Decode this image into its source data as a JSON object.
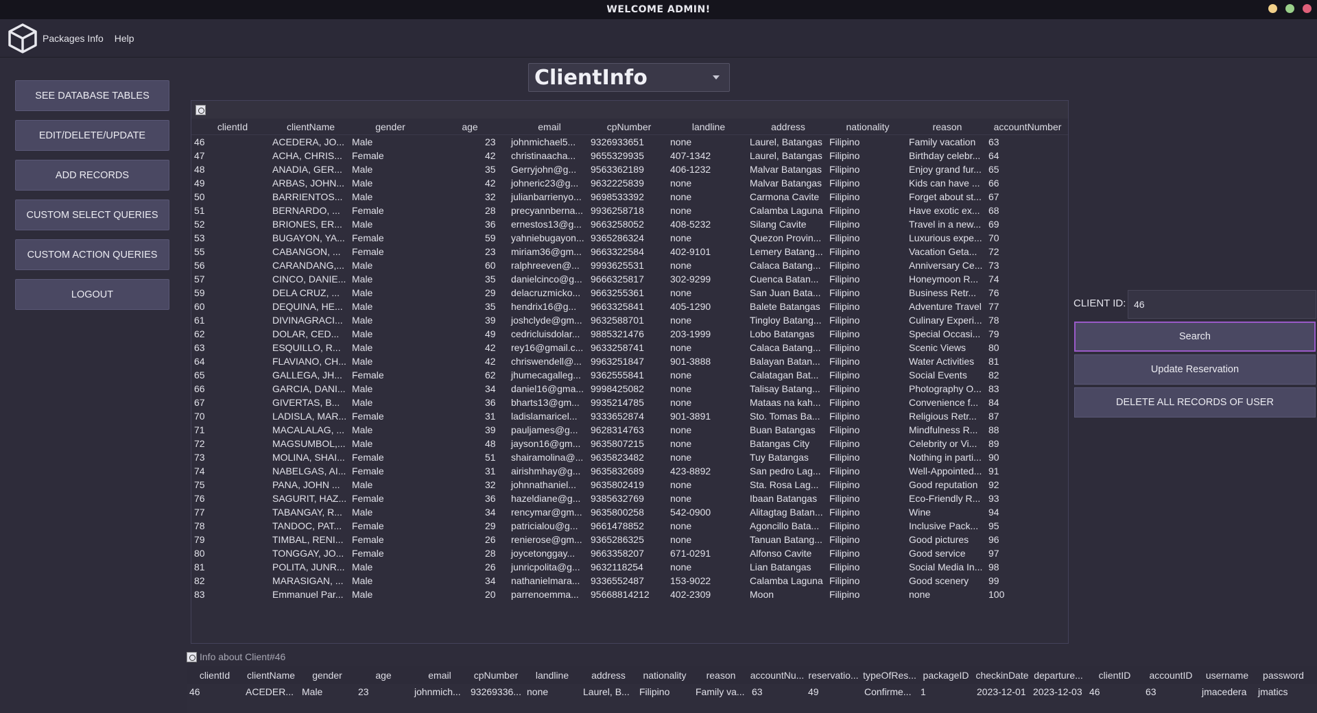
{
  "window": {
    "title": "WELCOME ADMIN!",
    "controls": [
      {
        "name": "minimize",
        "color": "#f2d08a"
      },
      {
        "name": "maximize",
        "color": "#9ad08a"
      },
      {
        "name": "close",
        "color": "#e0607a"
      }
    ]
  },
  "menu": {
    "items": [
      "Packages Info",
      "Help"
    ]
  },
  "sidebar": {
    "buttons": [
      "SEE DATABASE TABLES",
      "EDIT/DELETE/UPDATE",
      "ADD RECORDS",
      "CUSTOM SELECT QUERIES",
      "CUSTOM ACTION QUERIES",
      "LOGOUT"
    ]
  },
  "table_selector": {
    "value": "ClientInfo"
  },
  "main_table": {
    "columns": [
      "clientId",
      "clientName",
      "gender",
      "age",
      "email",
      "cpNumber",
      "landline",
      "address",
      "nationality",
      "reason",
      "accountNumber"
    ],
    "rows": [
      [
        "46",
        "ACEDERA, JO...",
        "Male",
        "23",
        "johnmichael5...",
        "9326933651",
        "none",
        "Laurel, Batangas",
        "Filipino",
        "Family vacation",
        "63"
      ],
      [
        "47",
        "ACHA, CHRIS...",
        "Female",
        "42",
        "christinaacha...",
        "9655329935",
        "407-1342",
        "Laurel, Batangas",
        "Filipino",
        "Birthday celebr...",
        "64"
      ],
      [
        "48",
        "ANADIA, GER...",
        "Male",
        "35",
        "Gerryjohn@g...",
        "9563362189",
        "406-1232",
        "Malvar Batangas",
        "Filipino",
        "Enjoy grand fur...",
        "65"
      ],
      [
        "49",
        "ARBAS, JOHN...",
        "Male",
        "42",
        "johneric23@g...",
        "9632225839",
        "none",
        "Malvar Batangas",
        "Filipino",
        "Kids can have ...",
        "66"
      ],
      [
        "50",
        "BARRIENTOS...",
        "Male",
        "32",
        "julianbarrienyo...",
        "9698533392",
        "none",
        "Carmona Cavite",
        "Filipino",
        "Forget about st...",
        "67"
      ],
      [
        "51",
        "BERNARDO, ...",
        "Female",
        "28",
        "precyannberna...",
        "9936258718",
        "none",
        "Calamba Laguna",
        "Filipino",
        "Have exotic ex...",
        "68"
      ],
      [
        "52",
        "BRIONES, ER...",
        "Male",
        "36",
        "ernestos13@g...",
        "9663258052",
        "408-5232",
        "Silang Cavite",
        "Filipino",
        "Travel in a new...",
        "69"
      ],
      [
        "53",
        "BUGAYON, YA...",
        "Female",
        "59",
        "yahniebugayon...",
        "9365286324",
        "none",
        "Quezon Provin...",
        "Filipino",
        "Luxurious expe...",
        "70"
      ],
      [
        "55",
        "CABANGON, ...",
        "Female",
        "23",
        "miriam36@gm...",
        "9663322584",
        "402-9101",
        "Lemery Batang...",
        "Filipino",
        "Vacation Geta...",
        "72"
      ],
      [
        "56",
        "CARANDANG,...",
        "Male",
        "60",
        "ralphreeven@...",
        "9993625531",
        "none",
        "Calaca Batang...",
        "Filipino",
        "Anniversary Ce...",
        "73"
      ],
      [
        "57",
        "CINCO, DANIE...",
        "Male",
        "35",
        "danielcinco@g...",
        "9666325817",
        "302-9299",
        "Cuenca Batan...",
        "Filipino",
        "Honeymoon R...",
        "74"
      ],
      [
        "59",
        "DELA CRUZ, ...",
        "Male",
        "29",
        "delacruzmicko...",
        "9663255361",
        "none",
        "San Juan Bata...",
        "Filipino",
        "Business Retr...",
        "76"
      ],
      [
        "60",
        "DEQUINA, HE...",
        "Male",
        "35",
        "hendrix16@g...",
        "9663325841",
        "405-1290",
        "Balete Batangas",
        "Filipino",
        "Adventure Travel",
        "77"
      ],
      [
        "61",
        "DIVINAGRACI...",
        "Male",
        "39",
        "joshclyde@gm...",
        "9632588701",
        "none",
        "Tingloy Batang...",
        "Filipino",
        "Culinary Experi...",
        "78"
      ],
      [
        "62",
        "DOLAR, CED...",
        "Male",
        "49",
        "cedricluisdolar...",
        "9885321476",
        "203-1999",
        "Lobo Batangas",
        "Filipino",
        "Special Occasi...",
        "79"
      ],
      [
        "63",
        "ESQUILLO, R...",
        "Male",
        "42",
        "rey16@gmail.c...",
        "9633258741",
        "none",
        "Calaca Batang...",
        "Filipino",
        "Scenic Views",
        "80"
      ],
      [
        "64",
        "FLAVIANO, CH...",
        "Male",
        "42",
        "chriswendell@...",
        "9963251847",
        "901-3888",
        "Balayan Batan...",
        "Filipino",
        "Water Activities",
        "81"
      ],
      [
        "65",
        "GALLEGA, JH...",
        "Female",
        "62",
        "jhumecagalleg...",
        "9362555841",
        "none",
        "Calatagan Bat...",
        "Filipino",
        "Social Events",
        "82"
      ],
      [
        "66",
        "GARCIA, DANI...",
        "Male",
        "34",
        "daniel16@gma...",
        "9998425082",
        "none",
        "Talisay Batang...",
        "Filipino",
        "Photography O...",
        "83"
      ],
      [
        "67",
        "GIVERTAS, B...",
        "Male",
        "36",
        "bharts13@gm...",
        "9935214785",
        "none",
        "Mataas na kah...",
        "Filipino",
        "Convenience f...",
        "84"
      ],
      [
        "70",
        "LADISLA, MAR...",
        "Female",
        "31",
        "ladislamaricel...",
        "9333652874",
        "901-3891",
        "Sto. Tomas Ba...",
        "Filipino",
        "Religious Retr...",
        "87"
      ],
      [
        "71",
        "MACALALAG, ...",
        "Male",
        "39",
        "pauljames@g...",
        "9628314763",
        "none",
        "Buan Batangas",
        "Filipino",
        "Mindfulness R...",
        "88"
      ],
      [
        "72",
        "MAGSUMBOL,...",
        "Male",
        "48",
        "jayson16@gm...",
        "9635807215",
        "none",
        "Batangas City",
        "Filipino",
        "Celebrity or Vi...",
        "89"
      ],
      [
        "73",
        "MOLINA, SHAI...",
        "Female",
        "51",
        "shairamolina@...",
        "9635823482",
        "none",
        "Tuy Batangas",
        "Filipino",
        "Nothing in parti...",
        "90"
      ],
      [
        "74",
        "NABELGAS, AI...",
        "Female",
        "31",
        "airishmhay@g...",
        "9635832689",
        "423-8892",
        "San pedro Lag...",
        "Filipino",
        "Well-Appointed...",
        "91"
      ],
      [
        "75",
        "PANA, JOHN ...",
        "Male",
        "32",
        "johnnathaniel...",
        "9635802419",
        "none",
        "Sta. Rosa Lag...",
        "Filipino",
        "Good reputation",
        "92"
      ],
      [
        "76",
        "SAGURIT, HAZ...",
        "Female",
        "36",
        "hazeldiane@g...",
        "9385632769",
        "none",
        "Ibaan Batangas",
        "Filipino",
        "Eco-Friendly R...",
        "93"
      ],
      [
        "77",
        "TABANGAY, R...",
        "Male",
        "34",
        "rencymar@gm...",
        "9635800258",
        "542-0900",
        "Alitagtag Batan...",
        "Filipino",
        "Wine",
        "94"
      ],
      [
        "78",
        "TANDOC, PAT...",
        "Female",
        "29",
        "patricialou@g...",
        "9661478852",
        "none",
        "Agoncillo Bata...",
        "Filipino",
        "Inclusive Pack...",
        "95"
      ],
      [
        "79",
        "TIMBAL, RENI...",
        "Female",
        "26",
        "renierose@gm...",
        "9365286325",
        "none",
        "Tanuan Batang...",
        "Filipino",
        "Good pictures",
        "96"
      ],
      [
        "80",
        "TONGGAY, JO...",
        "Female",
        "28",
        "joycetonggay...",
        "9663358207",
        "671-0291",
        "Alfonso Cavite",
        "Filipino",
        "Good service",
        "97"
      ],
      [
        "81",
        "POLITA, JUNR...",
        "Male",
        "26",
        "junricpolita@g...",
        "9632118254",
        "none",
        "Lian Batangas",
        "Filipino",
        "Social Media In...",
        "98"
      ],
      [
        "82",
        "MARASIGAN, ...",
        "Male",
        "34",
        "nathanielmara...",
        "9336552487",
        "153-9022",
        "Calamba Laguna",
        "Filipino",
        "Good scenery",
        "99"
      ],
      [
        "83",
        "Emmanuel Par...",
        "Male",
        "20",
        "parrenoemma...",
        "95668814212",
        "402-2309",
        "Moon",
        "Filipino",
        "none",
        "100"
      ]
    ]
  },
  "search_panel": {
    "client_id_label": "CLIENT ID:",
    "client_id_value": "46",
    "search_label": "Search",
    "update_label": "Update Reservation",
    "delete_label": "DELETE ALL RECORDS OF USER"
  },
  "detail_panel": {
    "title": "Info about Client#46",
    "columns": [
      "clientId",
      "clientName",
      "gender",
      "age",
      "email",
      "cpNumber",
      "landline",
      "address",
      "nationality",
      "reason",
      "accountNu...",
      "reservatio...",
      "typeOfRes...",
      "packageID",
      "checkinDate",
      "departure...",
      "clientID",
      "accountID",
      "username",
      "password"
    ],
    "row": [
      "46",
      "ACEDER...",
      "Male",
      "23",
      "johnmich...",
      "93269336...",
      "none",
      "Laurel, B...",
      "Filipino",
      "Family va...",
      "63",
      "49",
      "Confirme...",
      "1",
      "2023-12-01",
      "2023-12-03",
      "46",
      "63",
      "jmacedera",
      "jmatics"
    ]
  },
  "colors": {
    "background": "#2e2c3a",
    "button": "#4a4862",
    "accent_border": "#9a5ac8",
    "titlebar": "#15141c"
  },
  "icons": [
    "cube-logo-icon",
    "table-icon",
    "dropdown-arrow-icon"
  ]
}
